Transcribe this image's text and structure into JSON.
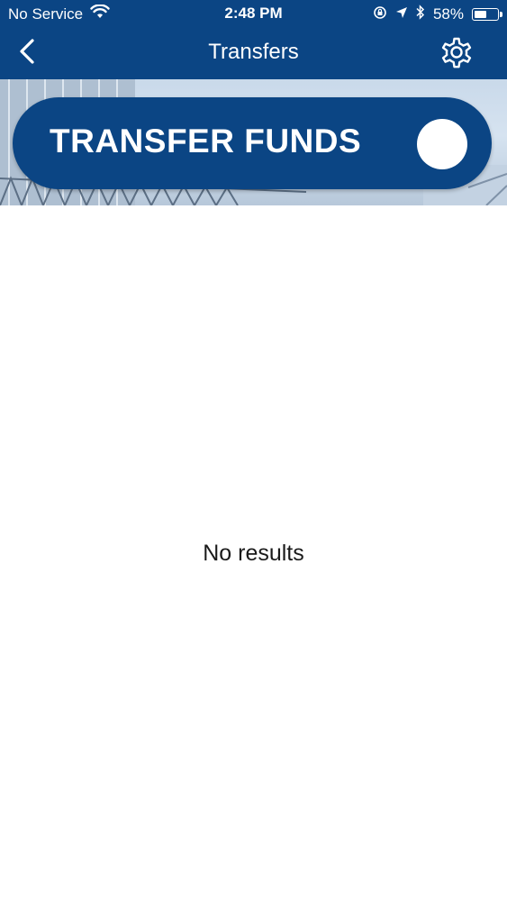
{
  "status_bar": {
    "carrier": "No Service",
    "time": "2:48 PM",
    "battery_percent": "58%",
    "battery_level": 0.58,
    "icons": [
      "wifi-icon",
      "orientation-lock-icon",
      "location-arrow-icon",
      "bluetooth-icon",
      "battery-icon"
    ]
  },
  "nav": {
    "title": "Transfers",
    "back_icon": "chevron-left-icon",
    "settings_icon": "gear-icon"
  },
  "hero": {
    "button_label": "TRANSFER FUNDS"
  },
  "content": {
    "empty_message": "No results"
  },
  "colors": {
    "brand": "#0b4584",
    "background": "#ffffff",
    "text": "#1a1a1a"
  }
}
